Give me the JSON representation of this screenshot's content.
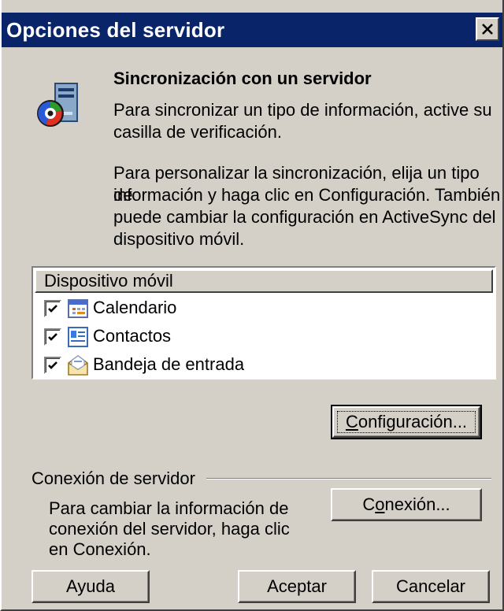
{
  "window": {
    "title": "Opciones del servidor",
    "close_icon": "close-icon"
  },
  "intro": {
    "icon": "sync-computer-icon",
    "heading": "Sincronización con un servidor",
    "para1_line1": "Para sincronizar un tipo de información, active su",
    "para1_line2": "casilla de verificación.",
    "para2_line1": "Para personalizar la sincronización, elija un tipo de",
    "para2_line2": "información y haga clic en Configuración. También",
    "para2_line3": "puede cambiar la configuración en ActiveSync del",
    "para2_line4": "dispositivo móvil."
  },
  "list": {
    "header": "Dispositivo móvil",
    "items": [
      {
        "label": "Calendario",
        "checked": true,
        "icon": "calendar-icon"
      },
      {
        "label": "Contactos",
        "checked": true,
        "icon": "contacts-card-icon"
      },
      {
        "label": "Bandeja de entrada",
        "checked": true,
        "icon": "inbox-envelope-icon"
      }
    ]
  },
  "buttons": {
    "configuracion_prefix": "",
    "configuracion_access": "C",
    "configuracion_rest": "onfiguración...",
    "conexion_prefix": "C",
    "conexion_access": "o",
    "conexion_rest": "nexión...",
    "ayuda": "Ayuda",
    "aceptar": "Aceptar",
    "cancelar": "Cancelar"
  },
  "server_connection": {
    "group_label": "Conexión de servidor",
    "line1": "Para cambiar la información de",
    "line2": "conexión del servidor, haga clic",
    "line3": "en Conexión."
  },
  "colors": {
    "titlebar": "#0a246a",
    "face": "#d4d0c8"
  }
}
